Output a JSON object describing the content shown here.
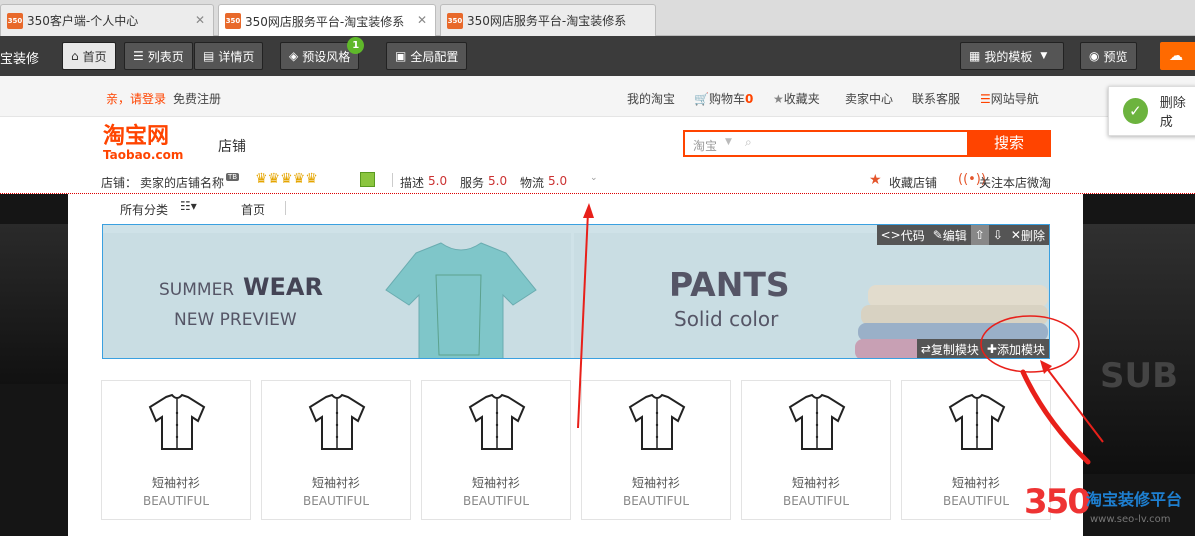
{
  "browser": {
    "tabs": [
      {
        "favicon": "350",
        "title": "350客户端-个人中心",
        "close": "✕"
      },
      {
        "favicon": "350",
        "title": "350网店服务平台-淘宝装修系",
        "close": "✕"
      },
      {
        "favicon": "350",
        "title": "350网店服务平台-淘宝装修系"
      }
    ]
  },
  "editor": {
    "app_title": "宝装修",
    "page_tabs": [
      "首页",
      "列表页",
      "详情页"
    ],
    "preset_style": "预设风格",
    "preset_badge": "1",
    "global_config": "全局配置",
    "my_templates": "我的模板",
    "preview": "预览"
  },
  "site_nav": {
    "login": "亲，请登录",
    "register": "免费注册",
    "links": [
      "我的淘宝",
      "购物车",
      "收藏夹",
      "卖家中心",
      "联系客服",
      "网站导航"
    ],
    "cart_count": "0"
  },
  "header": {
    "logo_cn": "淘宝网",
    "logo_en": "Taobao.com",
    "store_label": "店铺",
    "search_scope": "淘宝",
    "search_button": "搜索"
  },
  "shop_info": {
    "label": "店铺：",
    "name": "卖家的店铺名称",
    "tb_badge": "TB",
    "desc_label": "描述",
    "desc_score": "5.0",
    "service_label": "服务",
    "service_score": "5.0",
    "logistics_label": "物流",
    "logistics_score": "5.0",
    "favorite": "收藏店铺",
    "follow": "关注本店微淘"
  },
  "category_bar": {
    "all": "所有分类",
    "home": "首页"
  },
  "banner": {
    "left_line1_a": "SUMMER",
    "left_line1_b": "WEAR",
    "left_line2": "NEW PREVIEW",
    "right_line1": "PANTS",
    "right_line2": "Solid color"
  },
  "module_tools": {
    "code": "代码",
    "edit": "编辑",
    "delete": "删除",
    "copy": "复制模块",
    "add": "添加模块"
  },
  "products": [
    {
      "title": "短袖衬衫",
      "subtitle": "BEAUTIFUL"
    },
    {
      "title": "短袖衬衫",
      "subtitle": "BEAUTIFUL"
    },
    {
      "title": "短袖衬衫",
      "subtitle": "BEAUTIFUL"
    },
    {
      "title": "短袖衬衫",
      "subtitle": "BEAUTIFUL"
    },
    {
      "title": "短袖衬衫",
      "subtitle": "BEAUTIFUL"
    },
    {
      "title": "短袖衬衫",
      "subtitle": "BEAUTIFUL"
    }
  ],
  "notification": {
    "text": "删除成"
  },
  "background": {
    "right_text": "SUB"
  },
  "watermark": {
    "number": "350",
    "text": "淘宝装修平台",
    "url": "www.seo-lv.com"
  },
  "colors": {
    "accent": "#ff4400",
    "toolbar": "#3b3b3b",
    "selection": "#3aa0e0",
    "annotation": "#e8201a"
  }
}
